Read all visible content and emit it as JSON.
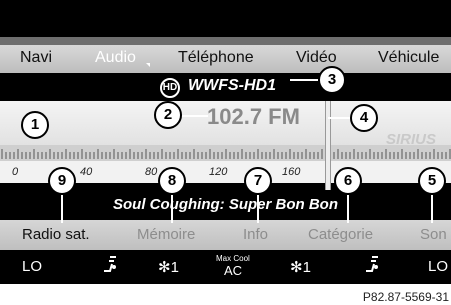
{
  "menu": {
    "items": [
      "Navi",
      "Audio",
      "Téléphone",
      "Vidéo",
      "Véhicule"
    ]
  },
  "station": {
    "hd_logo": "HD",
    "name": "WWFS-HD1",
    "frequency": "102.7 FM",
    "provider_logo": "SIRIUS"
  },
  "scale": {
    "labels": [
      "0",
      "40",
      "80",
      "120",
      "160"
    ]
  },
  "song": "Soul Coughing: Super Bon Bon",
  "bottom_menu": {
    "items": [
      "Radio sat.",
      "Mémoire",
      "Info",
      "Catégorie",
      "Son"
    ]
  },
  "climate": {
    "left_temp": "LO",
    "left_airflow_icon": "seat-airflow-icon",
    "left_fan": "1",
    "max_cool_label": "Max Cool",
    "ac_label": "AC",
    "right_fan": "1",
    "right_airflow_icon": "seat-airflow-icon",
    "right_temp": "LO"
  },
  "callouts": [
    "1",
    "2",
    "3",
    "4",
    "5",
    "6",
    "7",
    "8",
    "9"
  ],
  "caption": "P82.87-5569-31"
}
